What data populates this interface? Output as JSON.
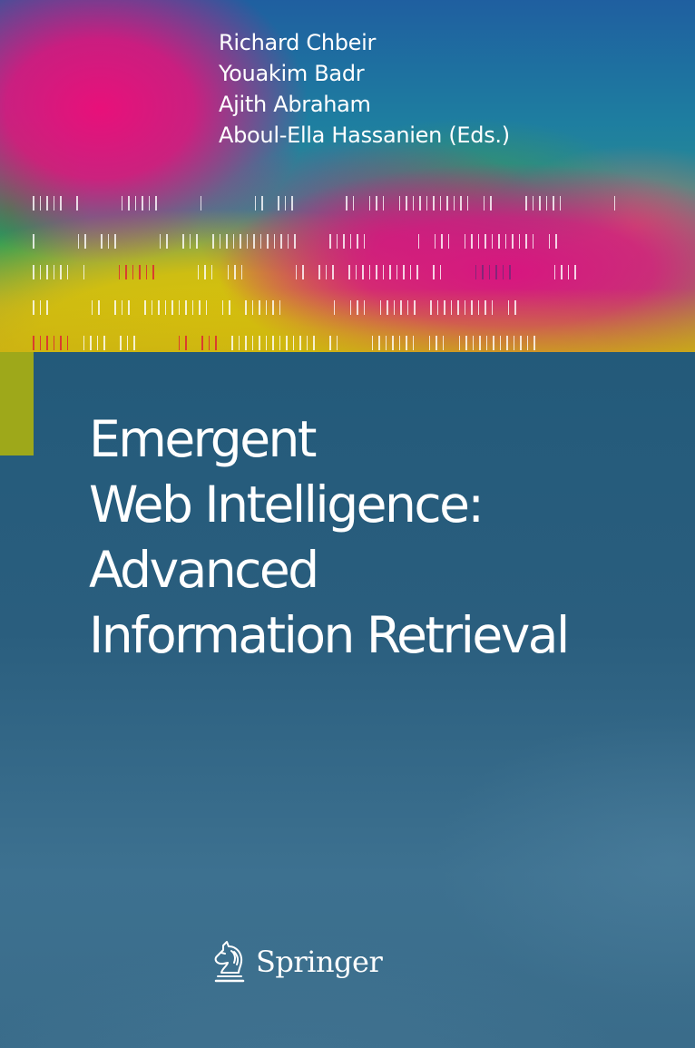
{
  "cover": {
    "authors": [
      "Richard Chbeir",
      "Youakim Badr",
      "Ajith Abraham",
      "Aboul-Ella Hassanien (Eds.)"
    ],
    "title_lines": [
      "Emergent",
      "Web Intelligence:",
      "Advanced",
      "Information Retrieval"
    ],
    "publisher": {
      "name": "Springer",
      "logo_icon": "knight-chess-horse-icon"
    },
    "colors": {
      "panel_blue": "#2a5e7e",
      "olive_strip": "#9ea81a",
      "magenta": "#e8107a",
      "yellow": "#d8c20a",
      "text": "#ffffff"
    },
    "barcode_patterns": [
      "11111 1    111111    1     11 111     11 111 11111111111 11   111111     1",
      "1    11 111    11 111 1111111111111   111111     1 111 11111111111 11",
      "111111 1   rrrrrr    111 111     11 111 11111111111 11   pppppp    1111",
      "111    11 111 1111111111 11 111111     1 111 111111 1111111111 11",
      "rrrrrr 1111 111    rr rrr 1111111111111 11   1111111 111 111111111111"
    ]
  }
}
